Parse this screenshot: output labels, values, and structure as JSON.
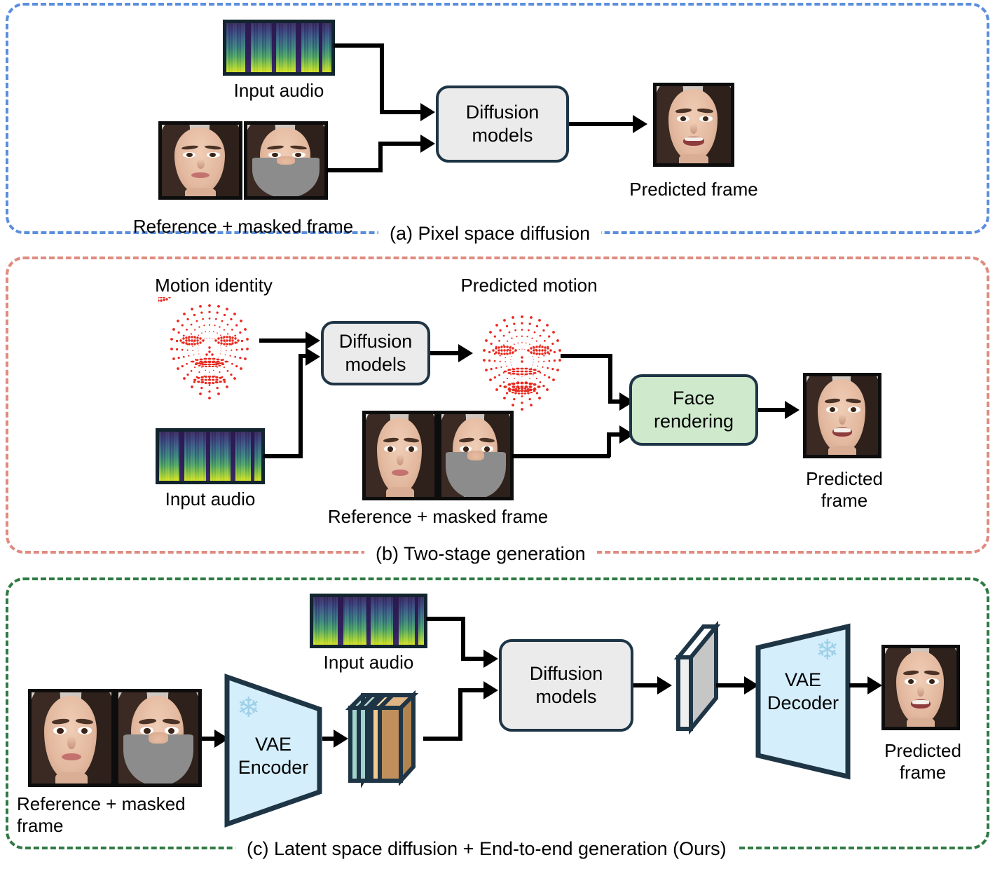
{
  "figure": {
    "title": "Comparison of talking-face generation pipelines",
    "colors": {
      "panel_a_border": "#5b8fdd",
      "panel_b_border": "#e08b80",
      "panel_c_border": "#2f7a43",
      "box_border": "#1e3546",
      "diffusion_box_fill": "#ebebeb",
      "face_rendering_fill": "#cfe9cd",
      "vae_fill": "#d4eefb",
      "point_cloud": "#e8281e",
      "mask_gray": "#8c8c8c",
      "latent_teal": "#9fd3cc",
      "latent_orange": "#e8b879",
      "latent_tan": "#c18f5c",
      "latent_gray": "#d3d3d3",
      "snowflake": "#9ed0e8"
    }
  },
  "panels": [
    {
      "id": "a",
      "caption": "(a) Pixel space diffusion",
      "nodes": {
        "input_audio_label": "Input audio",
        "reference_masked_label": "Reference + masked frame",
        "diffusion_box": "Diffusion models",
        "predicted_frame_label": "Predicted frame"
      }
    },
    {
      "id": "b",
      "caption": "(b) Two-stage generation",
      "nodes": {
        "motion_identity_label": "Motion identity",
        "predicted_motion_label": "Predicted motion",
        "input_audio_label": "Input audio",
        "reference_masked_label": "Reference + masked frame",
        "diffusion_box": "Diffusion models",
        "face_rendering_box": "Face rendering",
        "predicted_frame_label": "Predicted frame"
      }
    },
    {
      "id": "c",
      "caption": "(c) Latent space diffusion + End-to-end generation (Ours)",
      "nodes": {
        "reference_masked_label": "Reference + masked frame",
        "input_audio_label": "Input audio",
        "vae_encoder_box": "VAE Encoder",
        "diffusion_box": "Diffusion models",
        "vae_decoder_box": "VAE Decoder",
        "predicted_frame_label": "Predicted frame"
      }
    }
  ],
  "icons": {
    "snowflake": "❄",
    "frozen_note": "snowflake-frozen-weights"
  }
}
